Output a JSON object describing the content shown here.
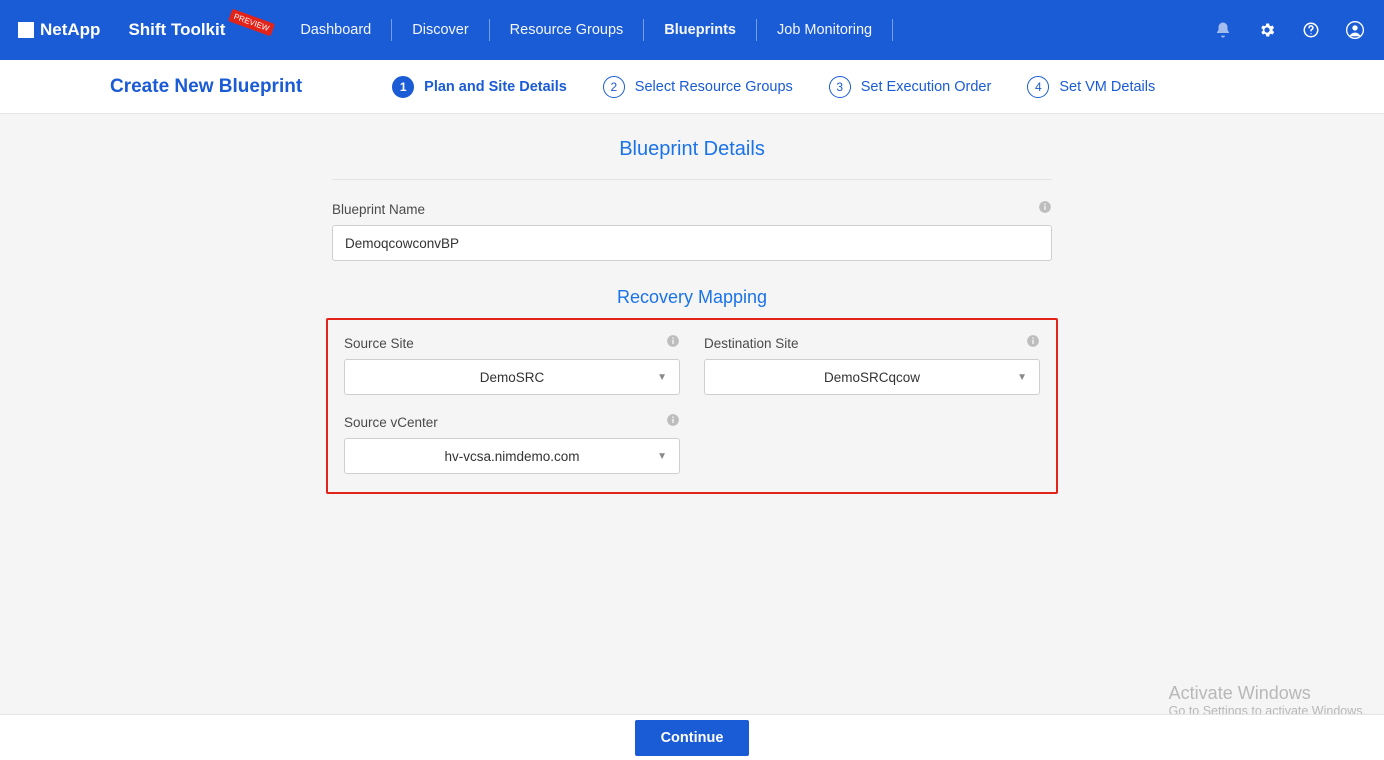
{
  "brand": "NetApp",
  "product": "Shift Toolkit",
  "preview_badge": "PREVIEW",
  "nav": {
    "dashboard": "Dashboard",
    "discover": "Discover",
    "resource_groups": "Resource Groups",
    "blueprints": "Blueprints",
    "job_monitoring": "Job Monitoring"
  },
  "page_title": "Create New Blueprint",
  "steps": {
    "s1": "Plan and Site Details",
    "s2": "Select Resource Groups",
    "s3": "Set Execution Order",
    "s4": "Set VM Details"
  },
  "sections": {
    "blueprint_details_title": "Blueprint Details",
    "recovery_mapping_title": "Recovery Mapping"
  },
  "form": {
    "blueprint_name_label": "Blueprint Name",
    "blueprint_name_value": "DemoqcowconvBP",
    "source_site_label": "Source Site",
    "source_site_value": "DemoSRC",
    "destination_site_label": "Destination Site",
    "destination_site_value": "DemoSRCqcow",
    "source_vcenter_label": "Source vCenter",
    "source_vcenter_value": "hv-vcsa.nimdemo.com"
  },
  "footer": {
    "continue": "Continue"
  },
  "watermark": {
    "line1": "Activate Windows",
    "line2": "Go to Settings to activate Windows."
  }
}
